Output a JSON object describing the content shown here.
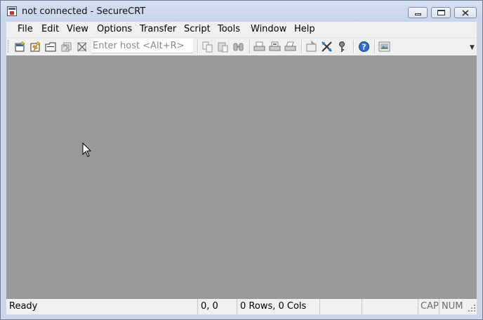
{
  "window": {
    "title": "not connected - SecureCRT"
  },
  "menu": {
    "items": [
      "File",
      "Edit",
      "View",
      "Options",
      "Transfer",
      "Script",
      "Tools",
      "Window",
      "Help"
    ]
  },
  "toolbar": {
    "host_placeholder": "Enter host <Alt+R>",
    "host_value": "",
    "icons": [
      "connect-icon",
      "quick-connect-icon",
      "connect-in-tab-icon",
      "reconnect-icon",
      "disconnect-icon",
      "copy-icon",
      "paste-icon",
      "find-icon",
      "print-icon",
      "print-selection-icon",
      "print-setup-icon",
      "session-options-icon",
      "global-options-icon",
      "keymap-icon",
      "help-icon",
      "about-icon"
    ]
  },
  "status": {
    "ready": "Ready",
    "position": "0, 0",
    "size": "0 Rows, 0 Cols",
    "cap": "CAP",
    "num": "NUM"
  }
}
